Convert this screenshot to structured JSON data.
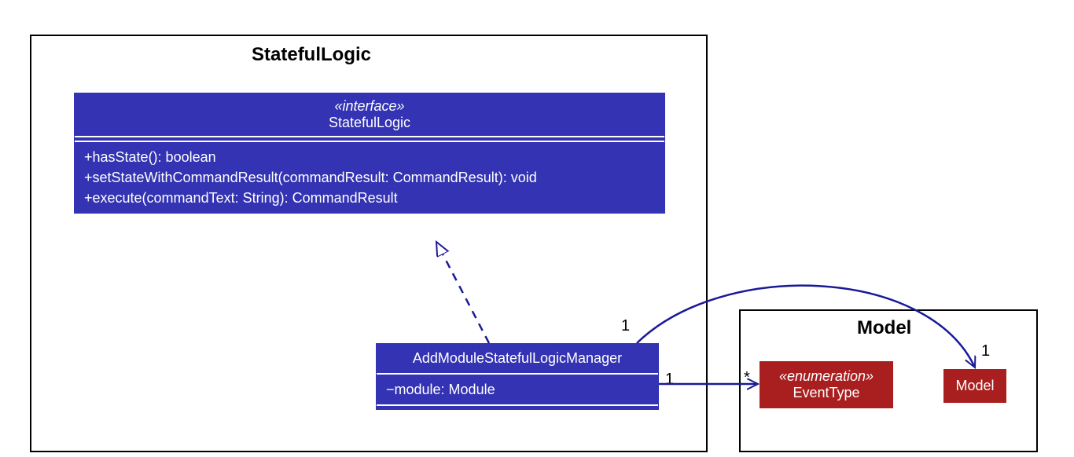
{
  "packages": {
    "statefulLogic": {
      "title": "StatefulLogic"
    },
    "model": {
      "title": "Model"
    }
  },
  "interface": {
    "stereo": "«interface»",
    "name": "StatefulLogic",
    "ops": [
      "+hasState(): boolean",
      "+setStateWithCommandResult(commandResult: CommandResult): void",
      "+execute(commandText: String): CommandResult"
    ]
  },
  "manager": {
    "name": "AddModuleStatefulLogicManager",
    "attrs": [
      "−module: Module"
    ]
  },
  "eventType": {
    "stereo": "«enumeration»",
    "name": "EventType"
  },
  "modelClass": {
    "name": "Model"
  },
  "mult": {
    "managerToEventType_src": "1",
    "managerToEventType_dst": "*",
    "managerToModel_src": "1",
    "managerToModel_dst": "1"
  }
}
